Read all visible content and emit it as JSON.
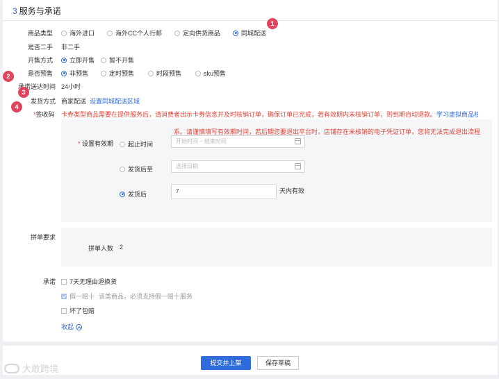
{
  "section": {
    "number": "3",
    "title": "服务与承诺"
  },
  "product_type": {
    "label": "商品类型",
    "options": [
      "海外进口",
      "海外CC个人行邮",
      "定向供货商品",
      "同城配送"
    ],
    "selected": "同城配送"
  },
  "second_hand": {
    "label": "是否二手",
    "value": "非二手"
  },
  "sale_mode": {
    "label": "开售方式",
    "options": [
      "立即开售",
      "暂不开售"
    ],
    "selected": "立即开售"
  },
  "presale": {
    "label": "是否预售",
    "options": [
      "非预售",
      "定时预售",
      "时段预售",
      "sku预售"
    ],
    "selected": "非预售"
  },
  "delivery_time": {
    "label": "承诺送达时间",
    "value": "24小时"
  },
  "shipping": {
    "label": "发货方式",
    "value": "商家配送",
    "link": "设置同城配送区域"
  },
  "coupon": {
    "label": "签收码",
    "required_mark": "*",
    "notice": "卡券类型商品需要在提供服务后，请消费者出示卡券信息并及时核销订单，确保订单已完成，若有效期内未核销订单，则到期自动退款。",
    "notice_link": "学习虚拟商品核销教程"
  },
  "validity": {
    "label": "设置有效期",
    "required_mark": "*",
    "warning": "系。请谨慎填写有效期时间，若后期您要退出平台时，店铺存在未核销的电子凭证订单，您将无法完成退出流程",
    "options": [
      {
        "label": "起止时间",
        "placeholder_start": "开始时间",
        "separator": "–",
        "placeholder_end": "结束时间"
      },
      {
        "label": "发货后至",
        "placeholder": "选择日期"
      },
      {
        "label": "发货后",
        "value": "7",
        "suffix": "天内有效"
      }
    ],
    "selected": "发货后"
  },
  "group_buy": {
    "label": "拼单要求",
    "count_label": "拼单人数",
    "count_value": "2"
  },
  "promises": {
    "label": "承诺",
    "items": [
      {
        "text": "7天无理由退换货",
        "checked": false,
        "disabled": false
      },
      {
        "text": "假一赔十",
        "note": "该类商品，必须支持假一赔十服务",
        "checked": true,
        "disabled": true
      },
      {
        "text": "坏了包赔",
        "checked": false,
        "disabled": false
      }
    ],
    "collapse": "收起"
  },
  "footer": {
    "submit": "提交并上架",
    "save_draft": "保存草稿"
  },
  "badges": [
    "1",
    "2",
    "3",
    "4"
  ],
  "watermark": "大敢跨境",
  "colors": {
    "primary": "#2f6bdc",
    "warning": "#e0463a",
    "badge": "#e0465e",
    "panel": "#f5f6f8"
  }
}
